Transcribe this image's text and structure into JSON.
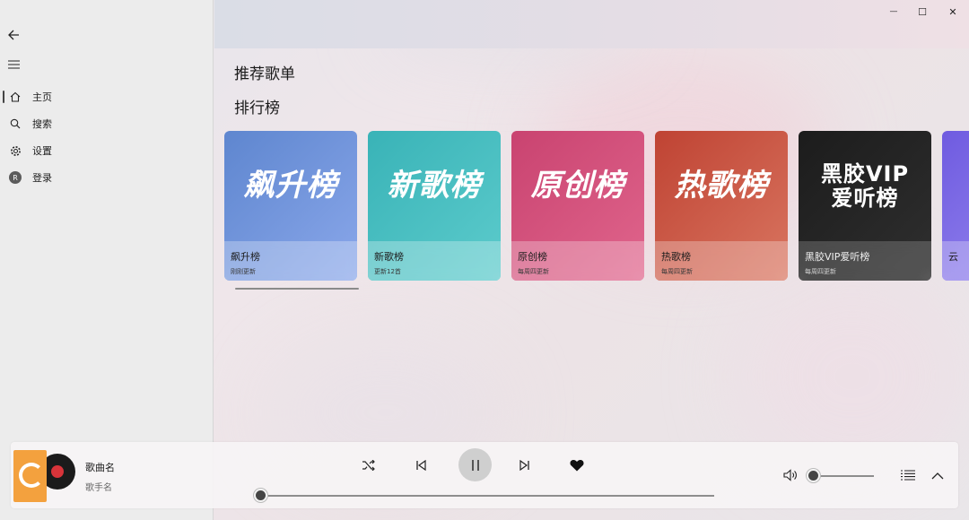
{
  "nav": {
    "back_icon": "back-arrow-icon",
    "menu_icon": "hamburger-icon",
    "items": [
      {
        "label": "主页",
        "icon": "home-icon",
        "active": true
      },
      {
        "label": "搜索",
        "icon": "search-icon"
      },
      {
        "label": "设置",
        "icon": "gear-icon"
      },
      {
        "label": "登录",
        "icon": "avatar-icon",
        "avatar_letter": "R"
      }
    ]
  },
  "window": {
    "minimize": "—",
    "maximize": "☐",
    "close": "✕"
  },
  "sections": {
    "recommended": "推荐歌单",
    "rankings": "排行榜"
  },
  "charts": [
    {
      "title": "飙升榜",
      "subtitle": "刚刚更新",
      "art_text": "飙升榜",
      "color1": "#5e86cf",
      "color2": "#7e9eea"
    },
    {
      "title": "新歌榜",
      "subtitle": "更新12首",
      "art_text": "新歌榜",
      "color1": "#3fb8bc",
      "color2": "#53c6c9"
    },
    {
      "title": "原创榜",
      "subtitle": "每周四更新",
      "art_text": "原创榜",
      "color1": "#cf4a74",
      "color2": "#dc5e86"
    },
    {
      "title": "热歌榜",
      "subtitle": "每周四更新",
      "art_text": "热歌榜",
      "color1": "#c44a3b",
      "color2": "#d46a58"
    },
    {
      "title": "黑胶VIP爱听榜",
      "subtitle": "每周四更新",
      "art_text": "黑胶VIP",
      "art_text2": "爱听榜",
      "color1": "#1f1f1f",
      "color2": "#333333"
    },
    {
      "title": "云",
      "subtitle": "",
      "art_text": "",
      "color1": "#7c6ae4",
      "color2": "#9488ee"
    }
  ],
  "player": {
    "song_title": "歌曲名",
    "artist": "歌手名",
    "progress": 0,
    "volume": 0,
    "liked": true,
    "icons": [
      "shuffle-icon",
      "previous-icon",
      "pause-icon",
      "next-icon",
      "heart-icon",
      "volume-icon",
      "playlist-icon",
      "chevron-up-icon"
    ]
  }
}
